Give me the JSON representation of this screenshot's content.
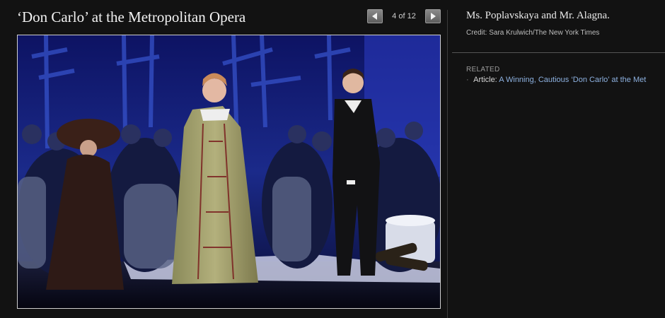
{
  "slideshow": {
    "title": "‘Don Carlo’ at the Metropolitan Opera",
    "counter": "4 of 12",
    "prev_icon": "arrow-left-icon",
    "next_icon": "arrow-right-icon"
  },
  "photo": {
    "alt": "Ms. Poplavskaya and Mr. Alagna on stage"
  },
  "sidebar": {
    "caption": "Ms. Poplavskaya and Mr. Alagna.",
    "credit": "Credit: Sara Krulwich/The New York Times",
    "related_heading": "RELATED",
    "related_items": [
      {
        "prefix": "Article:",
        "link": "A Winning, Cautious ‘Don Carlo’ at the Met"
      }
    ]
  },
  "colors": {
    "background": "#121212",
    "link": "#8db1e0",
    "stage_blue": "#1b2a8a"
  }
}
